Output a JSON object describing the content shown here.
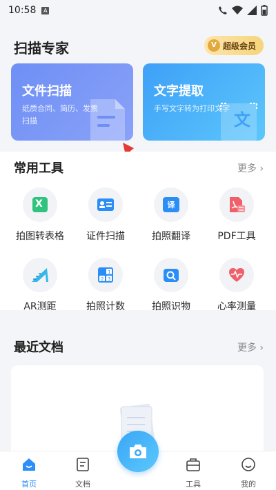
{
  "status": {
    "time": "10:58",
    "notif_letter": "A"
  },
  "header": {
    "title": "扫描专家",
    "vip_label": "超级会员",
    "vip_icon_letter": "V"
  },
  "hero": {
    "scan": {
      "title": "文件扫描",
      "subtitle": "纸质合同、简历、发票扫描"
    },
    "text": {
      "title": "文字提取",
      "subtitle": "手写文字转为打印文字",
      "deco_char": "文"
    }
  },
  "tools": {
    "title": "常用工具",
    "more": "更多 ›",
    "items": [
      {
        "label": "拍图转表格",
        "icon": "table-icon",
        "icon_char": "X"
      },
      {
        "label": "证件扫描",
        "icon": "id-card-icon"
      },
      {
        "label": "拍照翻译",
        "icon": "translate-icon",
        "icon_char": "译"
      },
      {
        "label": "PDF工具",
        "icon": "pdf-icon"
      },
      {
        "label": "AR测距",
        "icon": "ruler-icon"
      },
      {
        "label": "拍照计数",
        "icon": "count-icon"
      },
      {
        "label": "拍照识物",
        "icon": "search-object-icon"
      },
      {
        "label": "心率测量",
        "icon": "heart-icon"
      }
    ]
  },
  "recent": {
    "title": "最近文档",
    "more": "更多 ›"
  },
  "nav": {
    "home": "首页",
    "docs": "文档",
    "tools": "工具",
    "mine": "我的"
  },
  "colors": {
    "accent": "#2c8ef8",
    "scan_card": "#6e8ff5",
    "text_card": "#3ea0f8"
  }
}
